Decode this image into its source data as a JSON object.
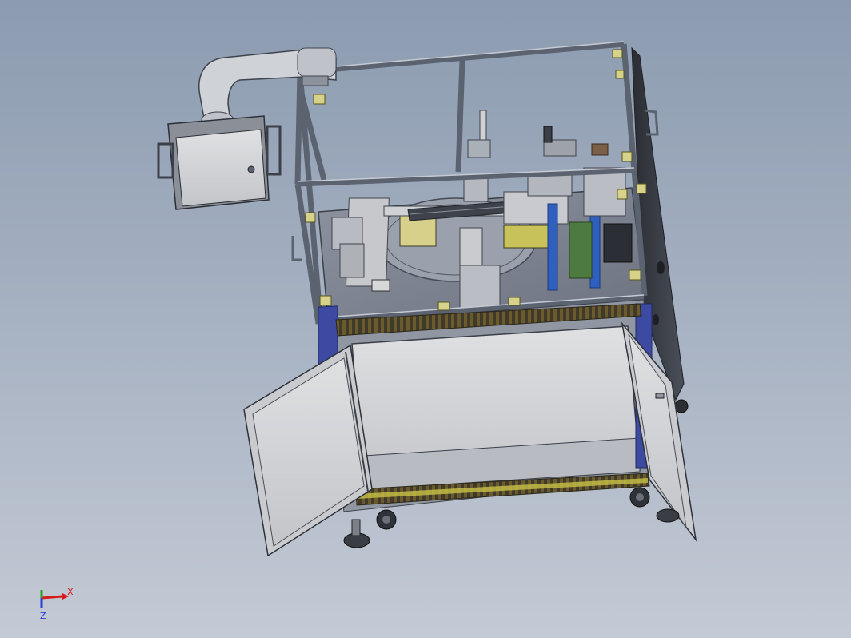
{
  "triad": {
    "x_label": "X",
    "z_label": "Z",
    "x_color": "#d41c1c",
    "y_color": "#1fa31f",
    "z_color": "#2a3fd6"
  },
  "model": {
    "frame_color": "#5b6270",
    "panel_color": "#d9dadc",
    "accent_blue": "#2f5fbf",
    "accent_yellow": "#c9c247"
  }
}
